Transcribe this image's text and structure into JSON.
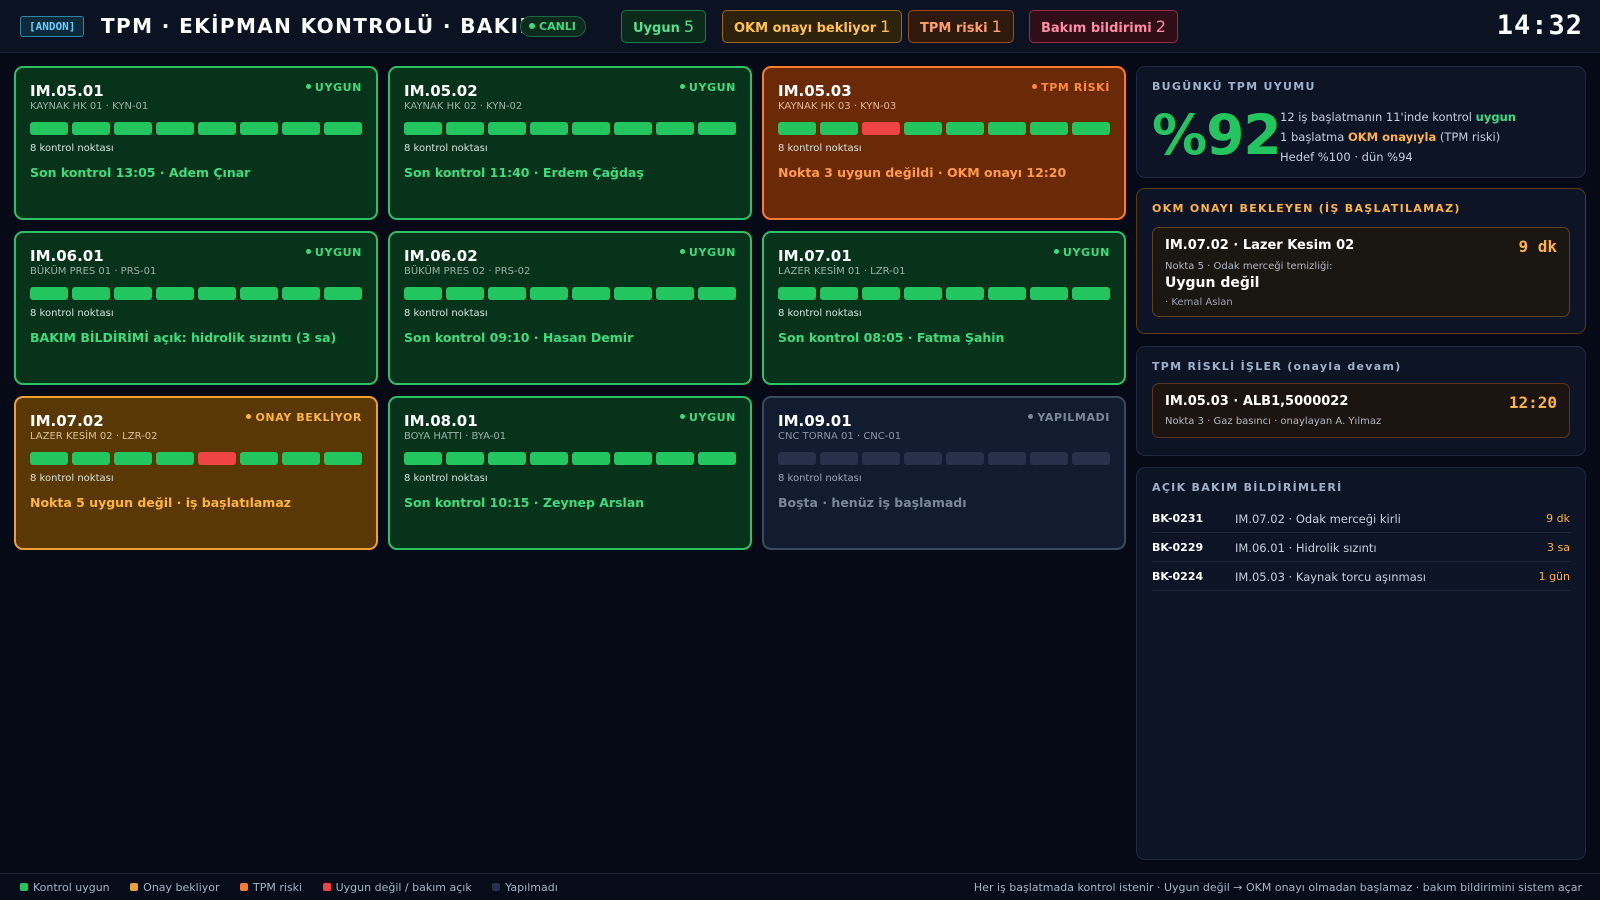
{
  "header": {
    "andon": "[ANDON]",
    "title": "TPM · EKİPMAN KONTROLÜ · BAKIM",
    "live": "CANLI",
    "stats": [
      {
        "label": "Uygun",
        "count": "5"
      },
      {
        "label": "OKM onayı bekliyor",
        "count": "1"
      },
      {
        "label": "TPM riski",
        "count": "1"
      },
      {
        "label": "Bakım bildirimi",
        "count": "2"
      }
    ],
    "clock": "14:32"
  },
  "colors": {
    "ok": "#22c55e",
    "bad": "#ef4444",
    "waiting": "#f0a030",
    "risk": "#ff7a2e",
    "idle": "#3c4a60"
  },
  "stations": [
    {
      "id": "IM.05.01",
      "status": "UYGUN",
      "sub": "KAYNAK HK 01 · KYN-01",
      "count": "8 kontrol noktası",
      "note": "Son kontrol 13:05 · Adem Çınar"
    },
    {
      "id": "IM.05.02",
      "status": "UYGUN",
      "sub": "KAYNAK HK 02 · KYN-02",
      "count": "8 kontrol noktası",
      "note": "Son kontrol 11:40 · Erdem Çağdaş"
    },
    {
      "id": "IM.05.03",
      "status": "TPM RİSKİ",
      "sub": "KAYNAK HK 03 · KYN-03",
      "count": "8 kontrol noktası",
      "note": "Nokta 3 uygun değildi · OKM onayı 12:20"
    },
    {
      "id": "IM.06.01",
      "status": "UYGUN",
      "sub": "BÜKÜM PRES 01 · PRS-01",
      "count": "8 kontrol noktası",
      "note": "BAKIM BİLDİRİMİ açık: hidrolik sızıntı (3 sa)"
    },
    {
      "id": "IM.06.02",
      "status": "UYGUN",
      "sub": "BÜKÜM PRES 02 · PRS-02",
      "count": "8 kontrol noktası",
      "note": "Son kontrol 09:10 · Hasan Demir"
    },
    {
      "id": "IM.07.01",
      "status": "UYGUN",
      "sub": "LAZER KESİM 01 · LZR-01",
      "count": "8 kontrol noktası",
      "note": "Son kontrol 08:05 · Fatma Şahin"
    },
    {
      "id": "IM.07.02",
      "status": "ONAY BEKLİYOR",
      "sub": "LAZER KESİM 02 · LZR-02",
      "count": "8 kontrol noktası",
      "note": "Nokta 5 uygun değil · iş başlatılamaz"
    },
    {
      "id": "IM.08.01",
      "status": "UYGUN",
      "sub": "BOYA HATTI · BYA-01",
      "count": "8 kontrol noktası",
      "note": "Son kontrol 10:15 · Zeynep Arslan"
    },
    {
      "id": "IM.09.01",
      "status": "YAPILMADI",
      "sub": "CNC TORNA 01 · CNC-01",
      "count": "8 kontrol noktası",
      "note": "Boşta · henüz iş başlamadı"
    }
  ],
  "compliance": {
    "heading": "BUGÜNKÜ TPM UYUMU",
    "value": "%92",
    "line1_pre": "12 iş başlatmanın 11'inde kontrol",
    "line1_em": "uygun",
    "line2_pre": "1 başlatma",
    "line2_em": "OKM onayıyla",
    "line2_post": "(TPM riski)",
    "line3": "Hedef %100 · dün %94"
  },
  "okm_pending": {
    "heading": "OKM ONAYI BEKLEYEN (İŞ BAŞLATILAMAZ)",
    "title": "IM.07.02 · Lazer Kesim 02",
    "wait": "9 dk",
    "sub": "Nokta 5 · Odak merceği temizliği:",
    "value": "Uygun değil",
    "by": "· Kemal Aslan"
  },
  "tpm_risk": {
    "heading": "TPM RİSKLİ İŞLER (onayla devam)",
    "title": "IM.05.03 · ALB1,5000022",
    "time": "12:20",
    "sub": "Nokta 3 · Gaz basıncı · onaylayan A. Yılmaz"
  },
  "maintenance": {
    "heading": "AÇIK BAKIM BİLDİRİMLERİ",
    "rows": [
      {
        "id": "BK-0231",
        "desc": "IM.07.02 · Odak merceği kirli",
        "age": "9 dk"
      },
      {
        "id": "BK-0229",
        "desc": "IM.06.01 · Hidrolik sızıntı",
        "age": "3 sa"
      },
      {
        "id": "BK-0224",
        "desc": "IM.05.03 · Kaynak torcu aşınması",
        "age": "1 gün"
      }
    ]
  },
  "footer": {
    "legend": [
      "Kontrol uygun",
      "Onay bekliyor",
      "TPM riski",
      "Uygun değil / bakım açık",
      "Yapılmadı"
    ],
    "note": "Her iş başlatmada kontrol istenir · Uygun değil → OKM onayı olmadan başlamaz · bakım bildirimini sistem açar"
  }
}
